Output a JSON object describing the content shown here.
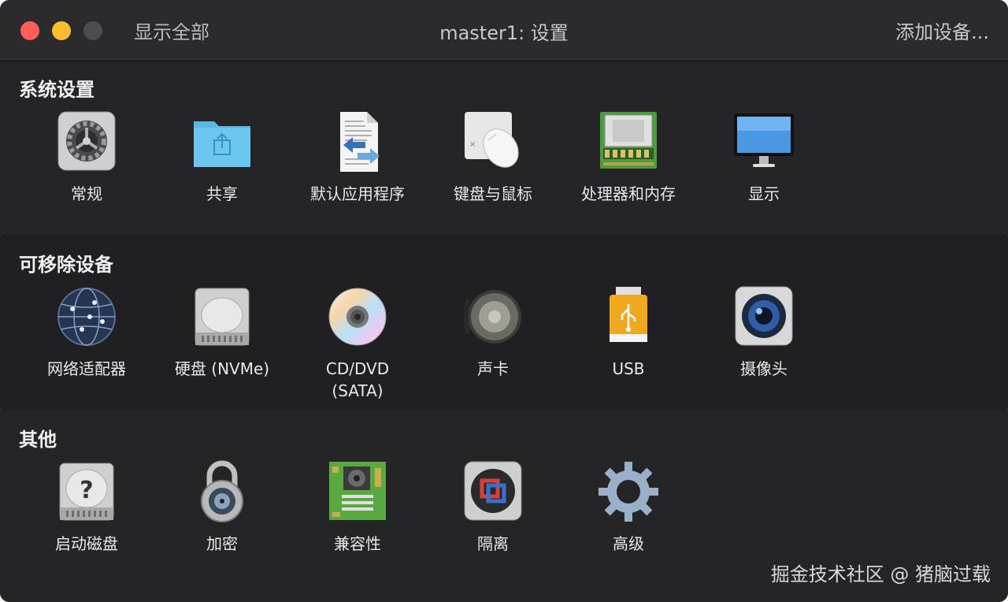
{
  "window": {
    "show_all": "显示全部",
    "title": "master1: 设置",
    "add_device": "添加设备..."
  },
  "sections": [
    {
      "title": "系统设置",
      "items": [
        {
          "label": "常规",
          "icon": "gear-general-icon"
        },
        {
          "label": "共享",
          "icon": "shared-folder-icon"
        },
        {
          "label": "默认应用程序",
          "icon": "default-apps-icon"
        },
        {
          "label": "键盘与鼠标",
          "icon": "keyboard-mouse-icon"
        },
        {
          "label": "处理器和内存",
          "icon": "cpu-memory-icon"
        },
        {
          "label": "显示",
          "icon": "display-icon"
        }
      ]
    },
    {
      "title": "可移除设备",
      "items": [
        {
          "label": "网络适配器",
          "icon": "network-globe-icon"
        },
        {
          "label": "硬盘 (NVMe)",
          "icon": "hard-disk-icon"
        },
        {
          "label": "CD/DVD\n(SATA)",
          "icon": "cd-dvd-icon"
        },
        {
          "label": "声卡",
          "icon": "speaker-icon"
        },
        {
          "label": "USB",
          "icon": "usb-drive-icon"
        },
        {
          "label": "摄像头",
          "icon": "camera-icon"
        }
      ]
    },
    {
      "title": "其他",
      "items": [
        {
          "label": "启动磁盘",
          "icon": "startup-disk-icon"
        },
        {
          "label": "加密",
          "icon": "padlock-icon"
        },
        {
          "label": "兼容性",
          "icon": "motherboard-icon"
        },
        {
          "label": "隔离",
          "icon": "isolation-icon"
        },
        {
          "label": "高级",
          "icon": "advanced-gear-icon"
        }
      ]
    }
  ],
  "watermark": "掘金技术社区 @ 猪脑过载",
  "colors": {
    "close": "#fe5f57",
    "minimize": "#febc2e",
    "maximize": "#4d4d50",
    "background": "#1f1f21"
  }
}
